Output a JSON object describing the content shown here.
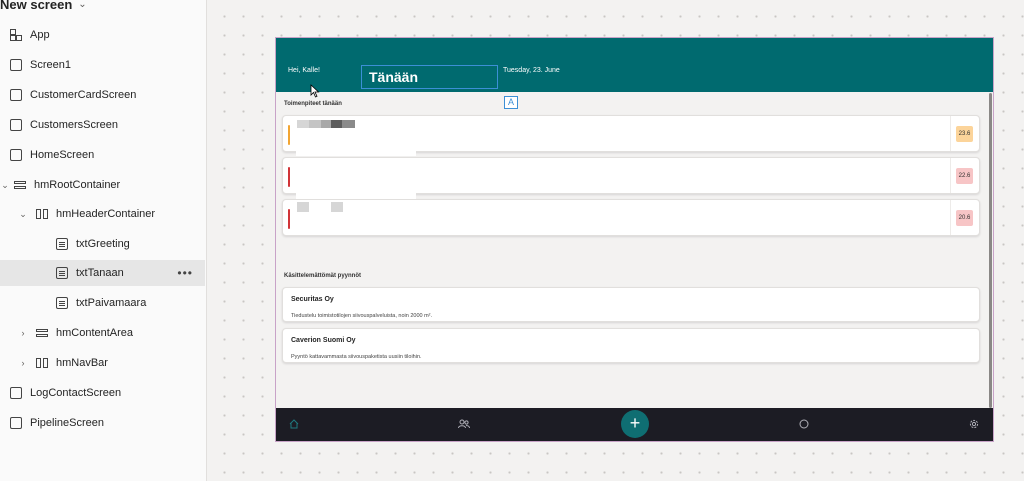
{
  "tree": {
    "screen_title": "New screen",
    "items": [
      {
        "label": "App",
        "icon": "app-icon"
      },
      {
        "label": "Screen1",
        "icon": "screen-icon"
      },
      {
        "label": "CustomerCardScreen",
        "icon": "screen-icon"
      },
      {
        "label": "CustomersScreen",
        "icon": "screen-icon"
      },
      {
        "label": "HomeScreen",
        "icon": "screen-icon"
      },
      {
        "label": "hmRootContainer",
        "icon": "vertical-container-icon"
      },
      {
        "label": "hmHeaderContainer",
        "icon": "horizontal-container-icon"
      },
      {
        "label": "txtGreeting",
        "icon": "label-icon"
      },
      {
        "label": "txtTanaan",
        "icon": "label-icon",
        "selected": true
      },
      {
        "label": "txtPaivamaara",
        "icon": "label-icon"
      },
      {
        "label": "hmContentArea",
        "icon": "vertical-container-icon"
      },
      {
        "label": "hmNavBar",
        "icon": "horizontal-container-icon"
      },
      {
        "label": "LogContactScreen",
        "icon": "screen-icon"
      },
      {
        "label": "PipelineScreen",
        "icon": "screen-icon"
      }
    ]
  },
  "app": {
    "header": {
      "greeting": "Hei, Kalle!",
      "today": "Tänään",
      "date": "Tuesday, 23. June"
    },
    "text_badge": "A",
    "tasks_title": "Toimenpiteet tänään",
    "tasks": [
      {
        "value": "23.6",
        "bar_color": "#f2a533",
        "badge_color": "#fcd49a"
      },
      {
        "value": "22.6",
        "bar_color": "#d13438",
        "badge_color": "#f7c5c6"
      },
      {
        "value": "20.6",
        "bar_color": "#d13438",
        "badge_color": "#f7c5c6"
      }
    ],
    "requests_title": "Käsittelemättömät pyynnöt",
    "requests": [
      {
        "company": "Securitas Oy",
        "description": "Tiedustelu toimistotilojen siivouspalveluista, noin 2000 m²."
      },
      {
        "company": "Caverion Suomi Oy",
        "description": "Pyyntö kattavammasta siivouspaketista uusiin tiloihin."
      }
    ],
    "nav": {
      "items": [
        "home-icon",
        "people-icon",
        "plus-icon",
        "circle-icon",
        "settings-icon"
      ],
      "fab_label": "+"
    }
  },
  "colors": {
    "header_bg": "#006a6f",
    "nav_bg": "#1c1c24",
    "fab_bg": "#0f6e72",
    "selection": "#3c8fd6"
  }
}
